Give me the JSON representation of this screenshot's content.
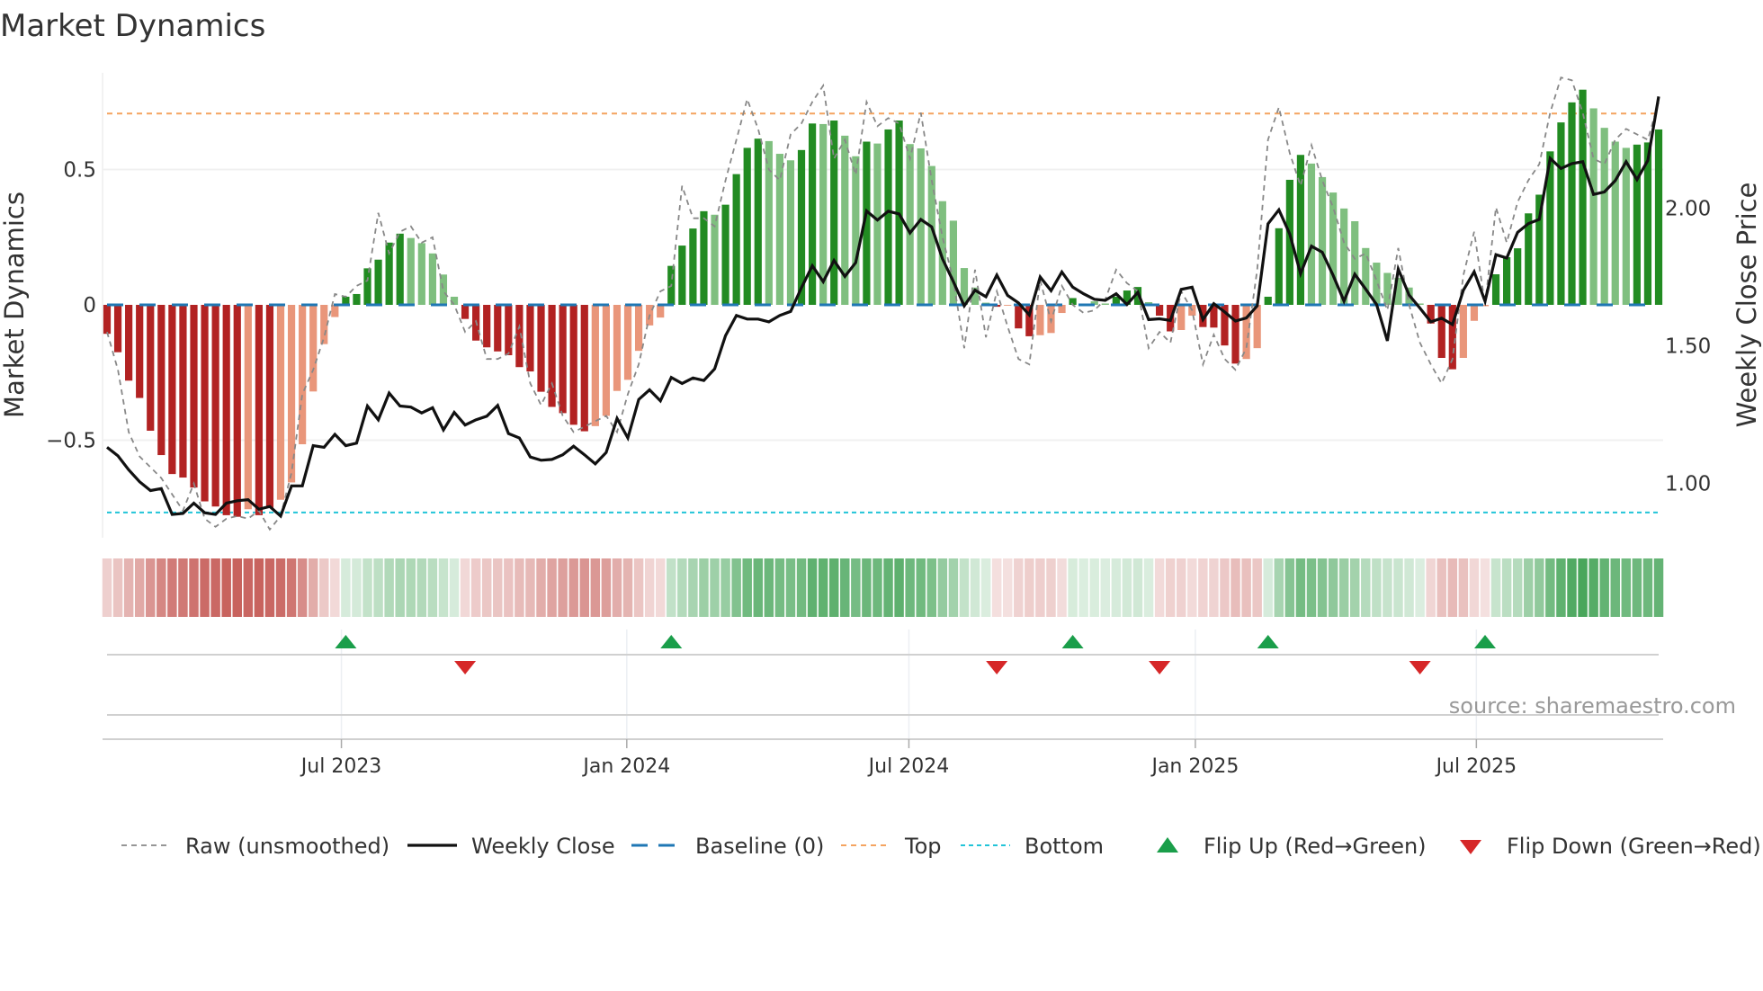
{
  "title": "Market Dynamics",
  "source": "source: sharemaestro.com",
  "chart_data": {
    "type": "bar",
    "title": "Market Dynamics",
    "ylabel": "Market Dynamics",
    "y2label": "Weekly Close Price",
    "ylim": [
      -0.89,
      0.86
    ],
    "y2lim": [
      0.62,
      2.52
    ],
    "yticks": [
      {
        "value": 0.5,
        "label": "0.5"
      },
      {
        "value": 0,
        "label": "0"
      },
      {
        "value": -0.5,
        "label": "−0.5"
      }
    ],
    "y2ticks": [
      {
        "value": 2.0,
        "label": "2.00"
      },
      {
        "value": 1.5,
        "label": "1.50"
      },
      {
        "value": 1.0,
        "label": "1.00"
      }
    ],
    "xticks": [
      {
        "week": 21.6,
        "label": "Jul 2023"
      },
      {
        "week": 47.9,
        "label": "Jan 2024"
      },
      {
        "week": 73.9,
        "label": "Jul 2024"
      },
      {
        "week": 100.3,
        "label": "Jan 2025"
      },
      {
        "week": 126.2,
        "label": "Jul 2025"
      }
    ],
    "top_level": 0.707,
    "bottom_level": -0.767,
    "baseline": 0,
    "dynamics": [
      -0.107,
      -0.175,
      -0.28,
      -0.344,
      -0.465,
      -0.555,
      -0.625,
      -0.638,
      -0.675,
      -0.726,
      -0.745,
      -0.777,
      -0.783,
      -0.755,
      -0.777,
      -0.751,
      -0.72,
      -0.656,
      -0.515,
      -0.32,
      -0.145,
      -0.045,
      0.03,
      0.04,
      0.135,
      0.167,
      0.23,
      0.263,
      0.247,
      0.228,
      0.19,
      0.112,
      0.03,
      -0.052,
      -0.132,
      -0.157,
      -0.172,
      -0.186,
      -0.23,
      -0.246,
      -0.321,
      -0.377,
      -0.4,
      -0.443,
      -0.467,
      -0.448,
      -0.41,
      -0.318,
      -0.277,
      -0.17,
      -0.076,
      -0.047,
      0.144,
      0.219,
      0.282,
      0.346,
      0.333,
      0.37,
      0.483,
      0.58,
      0.614,
      0.605,
      0.558,
      0.534,
      0.572,
      0.67,
      0.668,
      0.681,
      0.625,
      0.549,
      0.603,
      0.596,
      0.648,
      0.681,
      0.594,
      0.578,
      0.513,
      0.383,
      0.311,
      0.136,
      0.064,
      0.008,
      -0.007,
      -0.003,
      -0.087,
      -0.116,
      -0.112,
      -0.104,
      -0.03,
      0.025,
      0.003,
      0.013,
      0.005,
      0.03,
      0.053,
      0.066,
      0.01,
      -0.04,
      -0.098,
      -0.093,
      -0.04,
      -0.082,
      -0.084,
      -0.15,
      -0.217,
      -0.2,
      -0.16,
      0.03,
      0.283,
      0.462,
      0.554,
      0.522,
      0.472,
      0.415,
      0.356,
      0.309,
      0.21,
      0.156,
      0.118,
      0.1,
      0.064,
      0.005,
      -0.069,
      -0.196,
      -0.238,
      -0.196,
      -0.059,
      -0.005,
      0.113,
      0.176,
      0.209,
      0.338,
      0.407,
      0.567,
      0.674,
      0.748,
      0.795,
      0.726,
      0.654,
      0.603,
      0.58,
      0.592,
      0.6,
      0.648
    ],
    "shade": "DDDDDDDDDDDDDLDDLLLLLLDDDDDDLLLLLDDDDDDDDDDDDLLLLLLLDDDDLDDDDLLLDDLDLLDLDDLLLLLLLLDLDDLLLDLLLDDDLDDLLDDDDLLDDDDLLLLLLLLLLLDDDLLLDDDDDDDDDLLLLDDD",
    "weekly_close": [
      1.131,
      1.1,
      1.049,
      1.006,
      0.974,
      0.981,
      0.887,
      0.891,
      0.928,
      0.893,
      0.887,
      0.928,
      0.937,
      0.941,
      0.906,
      0.916,
      0.881,
      0.991,
      0.991,
      1.137,
      1.131,
      1.178,
      1.137,
      1.146,
      1.281,
      1.231,
      1.328,
      1.281,
      1.277,
      1.256,
      1.275,
      1.194,
      1.258,
      1.212,
      1.231,
      1.244,
      1.283,
      1.181,
      1.165,
      1.096,
      1.084,
      1.087,
      1.104,
      1.135,
      1.104,
      1.071,
      1.112,
      1.236,
      1.165,
      1.305,
      1.34,
      1.3,
      1.385,
      1.363,
      1.383,
      1.374,
      1.416,
      1.537,
      1.61,
      1.597,
      1.597,
      1.587,
      1.61,
      1.625,
      1.711,
      1.791,
      1.733,
      1.81,
      1.752,
      1.802,
      1.99,
      1.957,
      1.989,
      1.979,
      1.91,
      1.959,
      1.932,
      1.816,
      1.733,
      1.645,
      1.702,
      1.678,
      1.757,
      1.683,
      1.656,
      1.612,
      1.75,
      1.7,
      1.768,
      1.713,
      1.689,
      1.669,
      1.665,
      1.689,
      1.65,
      1.694,
      1.595,
      1.598,
      1.592,
      1.705,
      1.713,
      1.595,
      1.653,
      1.623,
      1.59,
      1.601,
      1.645,
      1.943,
      1.994,
      1.906,
      1.762,
      1.862,
      1.84,
      1.756,
      1.662,
      1.76,
      1.706,
      1.65,
      1.518,
      1.779,
      1.684,
      1.637,
      1.587,
      1.6,
      1.577,
      1.702,
      1.769,
      1.662,
      1.831,
      1.819,
      1.912,
      1.944,
      1.959,
      2.181,
      2.144,
      2.162,
      2.169,
      2.05,
      2.059,
      2.1,
      2.169,
      2.104,
      2.173,
      2.406
    ],
    "raw": [
      -0.1,
      -0.24,
      -0.47,
      -0.56,
      -0.6,
      -0.64,
      -0.7,
      -0.76,
      -0.66,
      -0.79,
      -0.82,
      -0.79,
      -0.78,
      -0.79,
      -0.76,
      -0.83,
      -0.78,
      -0.62,
      -0.33,
      -0.24,
      -0.12,
      0.04,
      0.03,
      0.07,
      0.09,
      0.34,
      0.19,
      0.27,
      0.29,
      0.23,
      0.25,
      0.05,
      0.0,
      -0.1,
      -0.06,
      -0.2,
      -0.2,
      -0.18,
      -0.08,
      -0.29,
      -0.37,
      -0.29,
      -0.41,
      -0.47,
      -0.45,
      -0.43,
      -0.41,
      -0.47,
      -0.33,
      -0.22,
      -0.04,
      0.05,
      0.07,
      0.44,
      0.32,
      0.32,
      0.29,
      0.46,
      0.61,
      0.76,
      0.65,
      0.5,
      0.46,
      0.63,
      0.67,
      0.75,
      0.81,
      0.54,
      0.61,
      0.48,
      0.75,
      0.66,
      0.69,
      0.67,
      0.54,
      0.71,
      0.46,
      0.25,
      0.09,
      -0.16,
      0.13,
      -0.12,
      0.05,
      -0.08,
      -0.2,
      -0.22,
      0.09,
      -0.06,
      0.07,
      0.0,
      -0.03,
      -0.02,
      0.02,
      0.13,
      0.08,
      0.05,
      -0.16,
      -0.1,
      -0.14,
      0.05,
      -0.02,
      -0.22,
      -0.11,
      -0.2,
      -0.24,
      -0.16,
      0.13,
      0.61,
      0.73,
      0.56,
      0.44,
      0.59,
      0.46,
      0.36,
      0.23,
      0.17,
      0.19,
      0.09,
      -0.02,
      0.21,
      0.0,
      -0.14,
      -0.22,
      -0.29,
      -0.2,
      0.11,
      0.27,
      0.0,
      0.36,
      0.23,
      0.38,
      0.46,
      0.52,
      0.71,
      0.84,
      0.83,
      0.71,
      0.54,
      0.52,
      0.61,
      0.65,
      0.63,
      0.61,
      0.75
    ],
    "flip_up_weeks": [
      22,
      52,
      89,
      107,
      127
    ],
    "flip_down_weeks": [
      33,
      82,
      97,
      121
    ],
    "legend": [
      {
        "label": "Raw (unsmoothed)",
        "kind": "raw"
      },
      {
        "label": "Weekly Close",
        "kind": "close"
      },
      {
        "label": "Baseline (0)",
        "kind": "baseline"
      },
      {
        "label": "Top",
        "kind": "top"
      },
      {
        "label": "Bottom",
        "kind": "bottom"
      },
      {
        "label": "Flip Up (Red→Green)",
        "kind": "up"
      },
      {
        "label": "Flip Down (Green→Red)",
        "kind": "down"
      }
    ],
    "legend_position": "bottom",
    "colors": {
      "pos_strong": "#228b22",
      "pos_weak": "#7fbf7f",
      "neg_strong": "#b22222",
      "neg_weak": "#e9967a",
      "close": "#111111",
      "raw": "#888888",
      "baseline": "#1f77b4",
      "top": "#f4a460",
      "bottom": "#22c4d8",
      "flip_up": "#1a9e4a",
      "flip_down": "#d62728"
    }
  }
}
